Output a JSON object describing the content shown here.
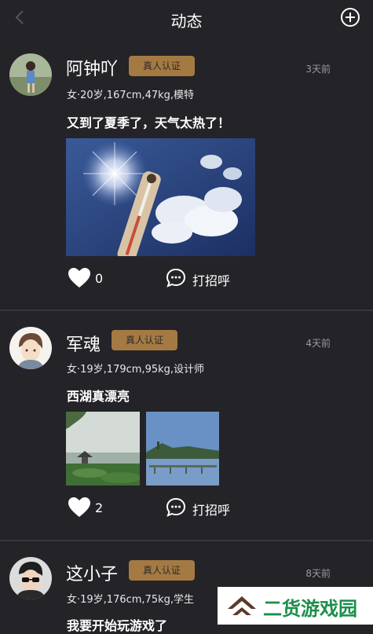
{
  "header": {
    "title": "动态"
  },
  "posts": [
    {
      "name": "阿钟吖",
      "badge": "真人认证",
      "time": "3天前",
      "info": "女·20岁,167cm,47kg,模特",
      "text": "又到了夏季了，天气太热了！",
      "likes": "0",
      "greet": "打招呼"
    },
    {
      "name": "军魂",
      "badge": "真人认证",
      "time": "4天前",
      "info": "女·19岁,179cm,95kg,设计师",
      "text": "西湖真漂亮",
      "likes": "2",
      "greet": "打招呼"
    },
    {
      "name": "这小子",
      "badge": "真人认证",
      "time": "8天前",
      "info": "女·19岁,176cm,75kg,学生",
      "text": "我要开始玩游戏了"
    }
  ],
  "watermark": {
    "text": "二货游戏园"
  },
  "icons": {
    "back": "chevron-left-icon",
    "add": "plus-circle-icon",
    "like": "heart-icon",
    "greet": "chat-bubble-icon"
  },
  "colors": {
    "background": "#242328",
    "badge": "#a47a42",
    "divider": "#38373d",
    "watermark_text": "#1b8f48"
  }
}
